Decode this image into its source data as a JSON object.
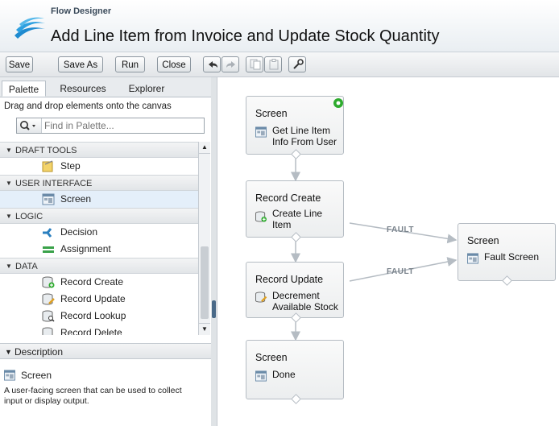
{
  "header": {
    "app_name": "Flow Designer",
    "flow_title": "Add Line Item from Invoice and Update Stock Quantity"
  },
  "toolbar": {
    "save_label": "Save",
    "save_as_label": "Save As",
    "run_label": "Run",
    "close_label": "Close",
    "icons": [
      "undo-icon",
      "redo-icon",
      "copy-icon",
      "paste-icon",
      "wrench-icon"
    ]
  },
  "left_panel": {
    "tabs": [
      {
        "label": "Palette",
        "active": true
      },
      {
        "label": "Resources",
        "active": false
      },
      {
        "label": "Explorer",
        "active": false
      }
    ],
    "hint": "Drag and drop elements onto the canvas",
    "search": {
      "placeholder": "Find in Palette..."
    },
    "categories": [
      {
        "label": "DRAFT TOOLS",
        "items": [
          {
            "label": "Step",
            "icon": "step-icon"
          }
        ]
      },
      {
        "label": "USER INTERFACE",
        "items": [
          {
            "label": "Screen",
            "icon": "screen-icon",
            "selected": true
          }
        ]
      },
      {
        "label": "LOGIC",
        "items": [
          {
            "label": "Decision",
            "icon": "decision-icon"
          },
          {
            "label": "Assignment",
            "icon": "assignment-icon"
          }
        ]
      },
      {
        "label": "DATA",
        "items": [
          {
            "label": "Record Create",
            "icon": "record-create-icon"
          },
          {
            "label": "Record Update",
            "icon": "record-update-icon"
          },
          {
            "label": "Record Lookup",
            "icon": "record-lookup-icon"
          },
          {
            "label": "Record Delete",
            "icon": "record-delete-icon"
          }
        ]
      }
    ],
    "description": {
      "header": "Description",
      "title": "Screen",
      "text": "A user-facing screen that can be used to collect input or display output."
    }
  },
  "canvas": {
    "nodes": [
      {
        "id": "n1",
        "type": "Screen",
        "name_line1": "Get Line Item",
        "name_line2": "Info From User",
        "icon": "screen-icon",
        "start": true
      },
      {
        "id": "n2",
        "type": "Record Create",
        "name_line1": "Create Line",
        "name_line2": "Item",
        "icon": "record-create-icon"
      },
      {
        "id": "n3",
        "type": "Record Update",
        "name_line1": "Decrement",
        "name_line2": "Available Stock",
        "icon": "record-update-icon"
      },
      {
        "id": "n4",
        "type": "Screen",
        "name_line1": "Done",
        "name_line2": "",
        "icon": "screen-icon"
      },
      {
        "id": "n5",
        "type": "Screen",
        "name_line1": "Fault Screen",
        "name_line2": "",
        "icon": "screen-icon"
      }
    ],
    "fault_label_1": "FAULT",
    "fault_label_2": "FAULT"
  },
  "colors": {
    "accent": "#2a7fbf",
    "start_badge": "#2eab2e",
    "selected_row": "#e4effa"
  }
}
